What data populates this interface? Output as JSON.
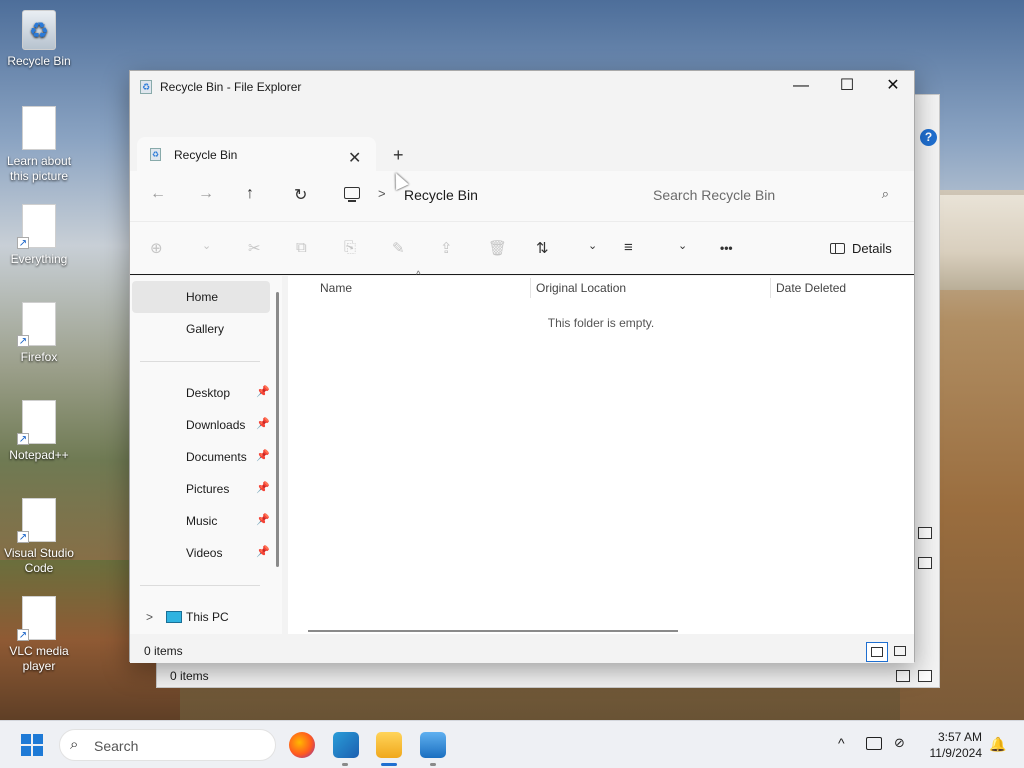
{
  "desktop": {
    "icons": [
      {
        "label": "Recycle Bin",
        "glyph": "♻"
      },
      {
        "label": "Learn about this picture"
      },
      {
        "label": "Everything"
      },
      {
        "label": "Firefox"
      },
      {
        "label": "Notepad++"
      },
      {
        "label": "Visual Studio Code"
      },
      {
        "label": "VLC media player"
      }
    ]
  },
  "back_window": {
    "status": "0 items",
    "help_glyph": "?"
  },
  "window": {
    "title": "Recycle Bin - File Explorer",
    "controls": {
      "minimize": "—",
      "maximize": "☐",
      "close": "✕"
    },
    "tab": {
      "label": "Recycle Bin",
      "close": "✕",
      "new_tab": "+"
    },
    "nav": {
      "back": "←",
      "forward": "→",
      "up": "↑",
      "refresh": "↻",
      "separator": ">",
      "crumb": "Recycle Bin"
    },
    "search": {
      "placeholder": "Search Recycle Bin",
      "icon_glyph": "⌕"
    },
    "commands": {
      "new": "⊕",
      "new_drop": "⌄",
      "cut": "✂",
      "copy": "⧉",
      "paste": "⎘",
      "rename": "✎",
      "share": "⇪",
      "delete": "🗑",
      "sort": "⇅",
      "sort_drop": "⌄",
      "view": "≡",
      "view_drop": "⌄",
      "more": "•••",
      "details": "Details"
    },
    "sidebar": {
      "items": [
        {
          "label": "Home",
          "selected": true
        },
        {
          "label": "Gallery"
        },
        {
          "label": "Desktop",
          "pinned": true
        },
        {
          "label": "Downloads",
          "pinned": true
        },
        {
          "label": "Documents",
          "pinned": true
        },
        {
          "label": "Pictures",
          "pinned": true
        },
        {
          "label": "Music",
          "pinned": true
        },
        {
          "label": "Videos",
          "pinned": true
        },
        {
          "label": "This PC"
        }
      ],
      "pin_glyph": "📌",
      "chevron": ">"
    },
    "columns": [
      "Name",
      "Original Location",
      "Date Deleted"
    ],
    "sort_caret": "^",
    "empty_message": "This folder is empty.",
    "status": "0 items"
  },
  "taskbar": {
    "search_placeholder": "Search",
    "search_icon": "⌕",
    "tray_chevron": "^",
    "time": "3:57 AM",
    "date": "11/9/2024",
    "bell": "🔔"
  }
}
